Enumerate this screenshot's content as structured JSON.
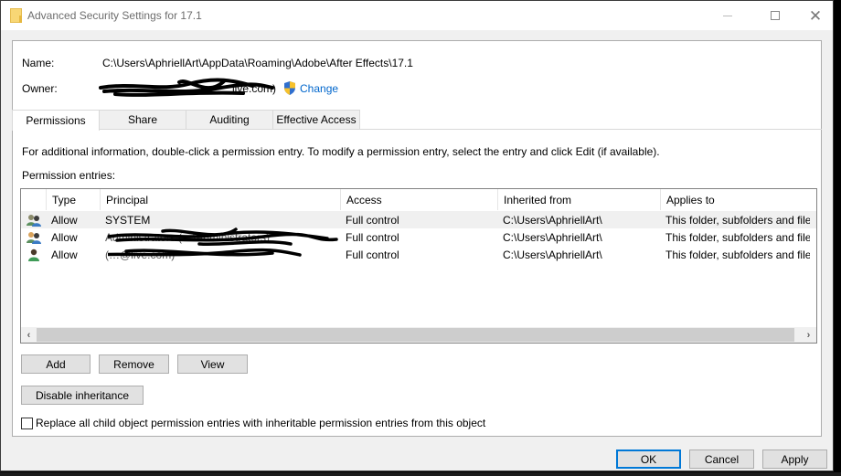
{
  "window": {
    "title": "Advanced Security Settings for 17.1",
    "controls": {
      "minimize": "minimize",
      "maximize": "maximize",
      "close": "close"
    }
  },
  "header": {
    "name_label": "Name:",
    "name_value": "C:\\Users\\AphriellArt\\AppData\\Roaming\\Adobe\\After Effects\\17.1",
    "owner_label": "Owner:",
    "owner_value_visible": "live.com)",
    "owner_redacted": true,
    "change_link": "Change",
    "change_icon": "uac-shield-icon",
    "link_color": "#0066cc"
  },
  "tabs": [
    {
      "label": "Permissions",
      "active": true
    },
    {
      "label": "Share",
      "active": false
    },
    {
      "label": "Auditing",
      "active": false
    },
    {
      "label": "Effective Access",
      "active": false
    }
  ],
  "permissions": {
    "info_text": "For additional information, double-click a permission entry. To modify a permission entry, select the entry and click Edit (if available).",
    "entries_label": "Permission entries:",
    "columns": [
      "Type",
      "Principal",
      "Access",
      "Inherited from",
      "Applies to"
    ],
    "rows": [
      {
        "icon": "group-users-icon",
        "type": "Allow",
        "principal": "SYSTEM",
        "principal_redacted": false,
        "access": "Full control",
        "inherited_from": "C:\\Users\\AphriellArt\\",
        "applies_to": "This folder, subfolders and files",
        "selected": true
      },
      {
        "icon": "group-users-icon",
        "type": "Allow",
        "principal": "Administrators (…\\Administrators)",
        "principal_redacted": true,
        "access": "Full control",
        "inherited_from": "C:\\Users\\AphriellArt\\",
        "applies_to": "This folder, subfolders and files",
        "selected": false
      },
      {
        "icon": "single-user-icon",
        "type": "Allow",
        "principal": "(…@live.com)",
        "principal_redacted": true,
        "access": "Full control",
        "inherited_from": "C:\\Users\\AphriellArt\\",
        "applies_to": "This folder, subfolders and files",
        "selected": false
      }
    ],
    "scroll_left": "‹",
    "scroll_right": "›"
  },
  "buttons": {
    "add": "Add",
    "remove": "Remove",
    "view": "View",
    "disable_inheritance": "Disable inheritance"
  },
  "replace_checkbox": {
    "label": "Replace all child object permission entries with inheritable permission entries from this object",
    "checked": false
  },
  "footer": {
    "ok": "OK",
    "cancel": "Cancel",
    "apply": "Apply",
    "accent_color": "#0078d7"
  }
}
